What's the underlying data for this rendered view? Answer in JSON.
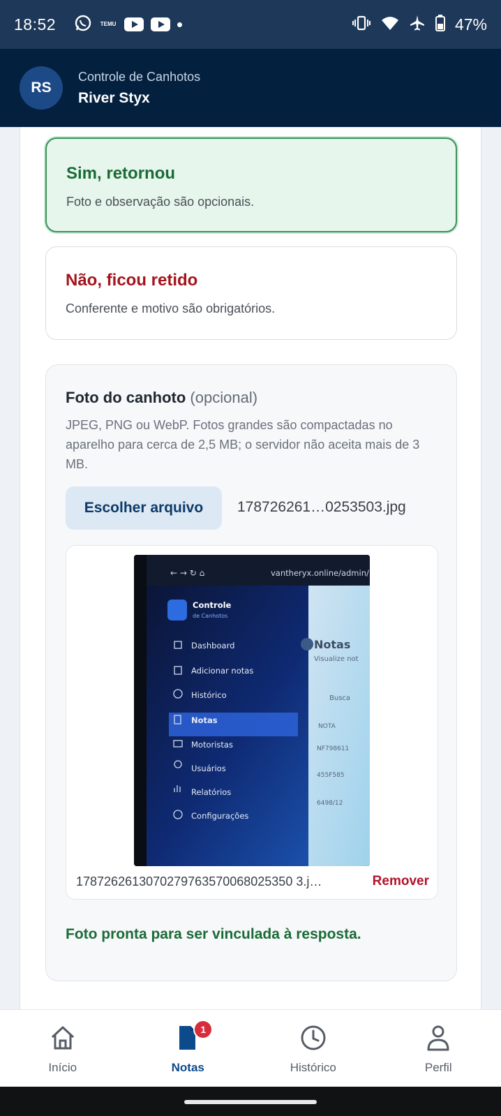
{
  "status_bar": {
    "time": "18:52",
    "temu_label": "TEMU",
    "battery": "47%",
    "icons": [
      "whatsapp-icon",
      "temu-icon",
      "youtube-icon",
      "youtube-icon",
      "dot-icon",
      "vibrate-icon",
      "wifi-icon",
      "airplane-icon",
      "battery-icon"
    ]
  },
  "header": {
    "avatar_initials": "RS",
    "app_title": "Controle de Canhotos",
    "user_name": "River Styx"
  },
  "options": {
    "yes": {
      "title": "Sim, retornou",
      "description": "Foto e observação são opcionais."
    },
    "no": {
      "title": "Não, ficou retido",
      "description": "Conferente e motivo são obrigatórios."
    }
  },
  "photo": {
    "title": "Foto do canhoto",
    "optional_label": "(opcional)",
    "help_text": "JPEG, PNG ou WebP. Fotos grandes são compactadas no aparelho para cerca de 2,5 MB; o servidor não aceita mais de 3 MB.",
    "choose_button": "Escolher arquivo",
    "selected_file": "178726261…0253503.jpg",
    "preview_file_name": "1787262613070279763570068025350 3.j…",
    "remove_label": "Remover",
    "ready_message": "Foto pronta para ser vinculada à resposta.",
    "thumbnail_text": {
      "url": "vantheryx.online/admin/",
      "brand_title": "Controle",
      "brand_subtitle": "de Canhotos",
      "menu": [
        "Dashboard",
        "Adicionar notas",
        "Histórico",
        "Notas",
        "Motoristas",
        "Usuários",
        "Relatórios",
        "Configurações"
      ],
      "page_title": "Notas",
      "page_subtitle": "Visualize not",
      "search": "Busca",
      "column": "NOTA",
      "rows": [
        "NF798611",
        "455F585",
        "6498/12"
      ]
    }
  },
  "bottom_nav": {
    "items": [
      {
        "label": "Início",
        "icon": "home-icon"
      },
      {
        "label": "Notas",
        "icon": "document-icon",
        "badge": "1"
      },
      {
        "label": "Histórico",
        "icon": "clock-icon"
      },
      {
        "label": "Perfil",
        "icon": "user-icon"
      }
    ],
    "active": "Notas"
  },
  "colors": {
    "status_bar": "#1d3858",
    "header": "#04203f",
    "success": "#1b6b36",
    "danger": "#a3141c",
    "accent": "#0d4a8c"
  }
}
